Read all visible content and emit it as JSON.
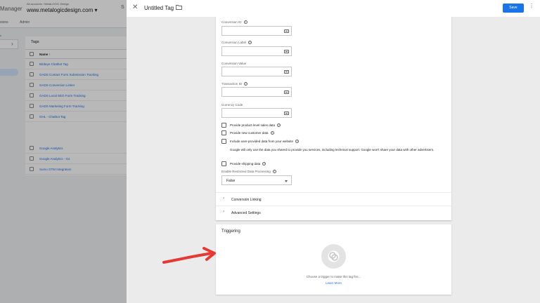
{
  "background": {
    "product_partial": "Manager",
    "breadcrumb": "All accounts › MetaLOGIC Design",
    "container": "www.metalogicdesign.com",
    "nav_tabs": [
      "sions",
      "Admin"
    ],
    "tags_card_title": "Tags",
    "name_header": "Name",
    "tag_rows": [
      "Birdeye Chatbot Tag",
      "GADS Contact Form Submission Tracking",
      "GADS Conversion Linker",
      "GADS Local SEO Form Tracking",
      "GADS Marketing Form Tracking",
      "GHL - Chatbot Tag",
      "Google Analytics",
      "Google Analytics - G4",
      "Sumo GTM Integration"
    ]
  },
  "panel": {
    "tag_title": "Untitled Tag",
    "save_label": "Save",
    "fields": [
      {
        "label": "Conversion ID",
        "value": ""
      },
      {
        "label": "Conversion Label",
        "value": ""
      },
      {
        "label": "Conversion Value",
        "value": ""
      },
      {
        "label": "Transaction ID",
        "value": ""
      },
      {
        "label": "Currency Code",
        "value": ""
      }
    ],
    "checkboxes": [
      {
        "label": "Provide product-level sales data",
        "checked": false
      },
      {
        "label": "Provide new customer data",
        "checked": false
      },
      {
        "label": "Include user-provided data from your website",
        "checked": false
      },
      {
        "label": "Provide shipping data",
        "checked": false
      }
    ],
    "user_data_note": "Google will only use the data you shared to provide you services, including technical support. Google won't share your data with other advertisers.",
    "restricted_label": "Enable Restricted Data Processing",
    "restricted_value": "False",
    "sections": [
      "Conversion Linking",
      "Advanced Settings"
    ],
    "triggering": {
      "title": "Triggering",
      "hint": "Choose a trigger to make this tag fire...",
      "learn_more": "Learn More"
    }
  },
  "icons": {
    "close": "close-icon",
    "folder": "folder-icon",
    "more": "more-vert-icon",
    "help": "help-icon",
    "variable": "variable-icon",
    "trigger": "trigger-icon",
    "annotation": "red-arrow-icon"
  },
  "colors": {
    "accent": "#1a73e8",
    "annotation": "#e53935"
  }
}
